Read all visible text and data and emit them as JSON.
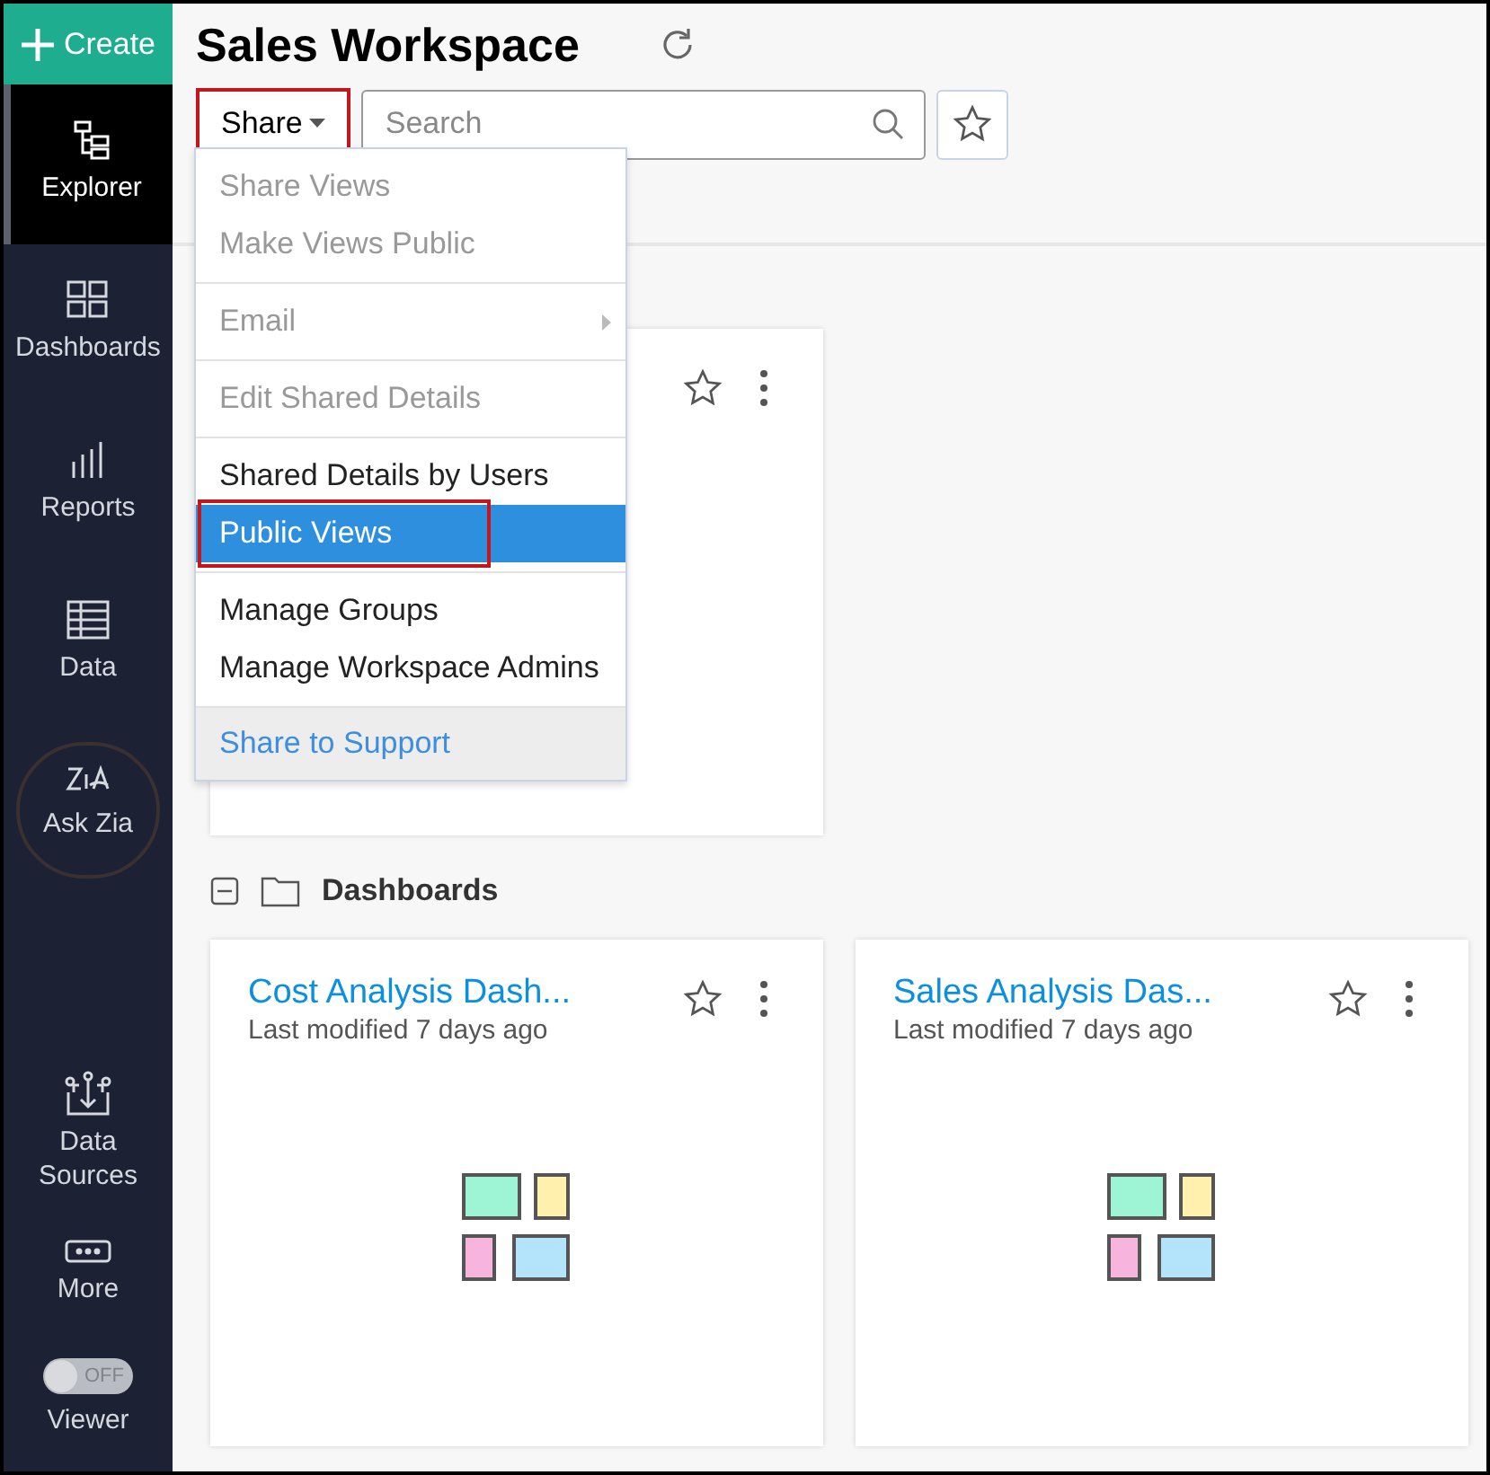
{
  "sidebar": {
    "create": {
      "label": "Create"
    },
    "items": [
      {
        "label": "Explorer",
        "kind": "nav",
        "selected": true
      },
      {
        "label": "Dashboards",
        "kind": "nav",
        "selected": false
      },
      {
        "label": "Reports",
        "kind": "nav",
        "selected": false
      },
      {
        "label": "Data",
        "kind": "nav",
        "selected": false
      },
      {
        "label": "Ask Zia",
        "kind": "zia",
        "selected": false
      }
    ],
    "bottom_items": [
      {
        "label": "Data Sources",
        "selected": false
      },
      {
        "label": "More",
        "selected": false
      }
    ],
    "viewer": {
      "label": "Viewer",
      "toggle_text": "OFF",
      "on": false
    }
  },
  "header": {
    "title": "Sales Workspace",
    "share_button": {
      "label": "Share",
      "annotated": true
    },
    "search": {
      "placeholder": "Search"
    }
  },
  "share_menu": {
    "groups": [
      [
        {
          "label": "Share Views",
          "kind": "item",
          "disabled": true,
          "selected": false,
          "submenu": false,
          "annotated": false
        },
        {
          "label": "Make Views Public",
          "kind": "item",
          "disabled": true,
          "selected": false,
          "submenu": false,
          "annotated": false
        }
      ],
      [
        {
          "label": "Email",
          "kind": "item",
          "disabled": true,
          "selected": false,
          "submenu": true,
          "annotated": false
        }
      ],
      [
        {
          "label": "Edit Shared Details",
          "kind": "item",
          "disabled": true,
          "selected": false,
          "submenu": false,
          "annotated": false
        }
      ],
      [
        {
          "label": "Shared Details by Users",
          "kind": "item",
          "disabled": false,
          "selected": false,
          "submenu": false,
          "annotated": false
        },
        {
          "label": "Public Views",
          "kind": "item",
          "disabled": false,
          "selected": true,
          "submenu": false,
          "annotated": true
        }
      ],
      [
        {
          "label": "Manage Groups",
          "kind": "item",
          "disabled": false,
          "selected": false,
          "submenu": false,
          "annotated": false
        },
        {
          "label": "Manage Workspace Admins",
          "kind": "item",
          "disabled": false,
          "selected": false,
          "submenu": false,
          "annotated": false
        }
      ],
      [
        {
          "label": "Share to Support",
          "kind": "footer",
          "disabled": false,
          "selected": false,
          "submenu": false,
          "annotated": false
        }
      ]
    ]
  },
  "sections": [
    {
      "title": "Dashboards",
      "expanded": true,
      "cards": [
        {
          "title": "Cost Analysis Dash...",
          "subtitle": "Last modified 7 days ago"
        },
        {
          "title": "Sales Analysis Das...",
          "subtitle": "Last modified 7 days ago"
        }
      ]
    }
  ]
}
